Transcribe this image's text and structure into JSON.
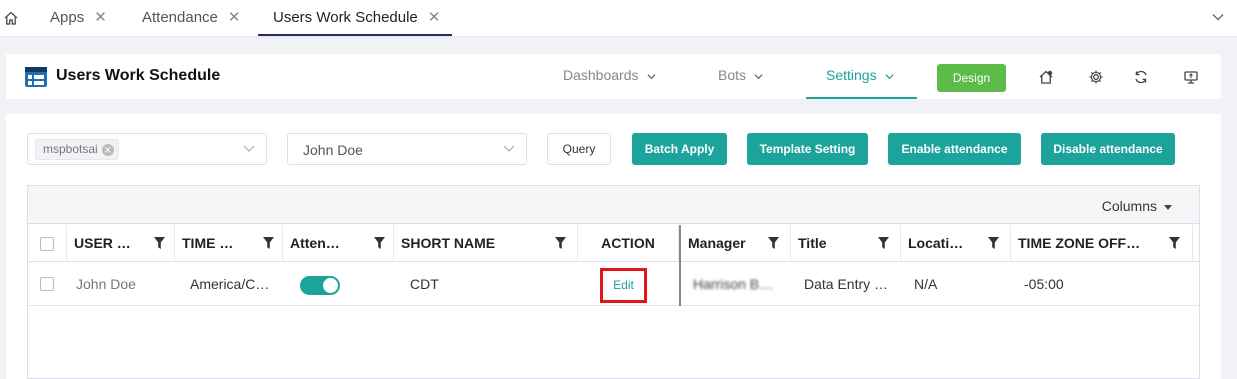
{
  "tabs": [
    {
      "label": "Apps",
      "close": "✕"
    },
    {
      "label": "Attendance",
      "close": "✕"
    },
    {
      "label": "Users Work Schedule",
      "close": "✕"
    }
  ],
  "header": {
    "title": "Users Work Schedule",
    "nav": [
      {
        "label": "Dashboards"
      },
      {
        "label": "Bots"
      },
      {
        "label": "Settings"
      }
    ],
    "design_label": "Design"
  },
  "filters": {
    "tag": "mspbotsai",
    "user_value": "John Doe"
  },
  "buttons": {
    "query": "Query",
    "batch_apply": "Batch Apply",
    "template_setting": "Template Setting",
    "enable_attendance": "Enable attendance",
    "disable_attendance": "Disable attendance"
  },
  "table": {
    "columns_label": "Columns",
    "headers": [
      "USER …",
      "TIME …",
      "Atten…",
      "SHORT NAME",
      "ACTION",
      "Manager",
      "Title",
      "Locati…",
      "TIME ZONE OFF…"
    ],
    "row": {
      "user": "John Doe",
      "time": "America/C…",
      "attendance": true,
      "short_name": "CDT",
      "action": "Edit",
      "manager": "Harrison B…",
      "title": "Data Entry …",
      "location": "N/A",
      "tz_offset": "-05:00"
    }
  },
  "colors": {
    "accent": "#1ba39c",
    "design": "#5dbb4a",
    "highlight": "#e0161b"
  }
}
